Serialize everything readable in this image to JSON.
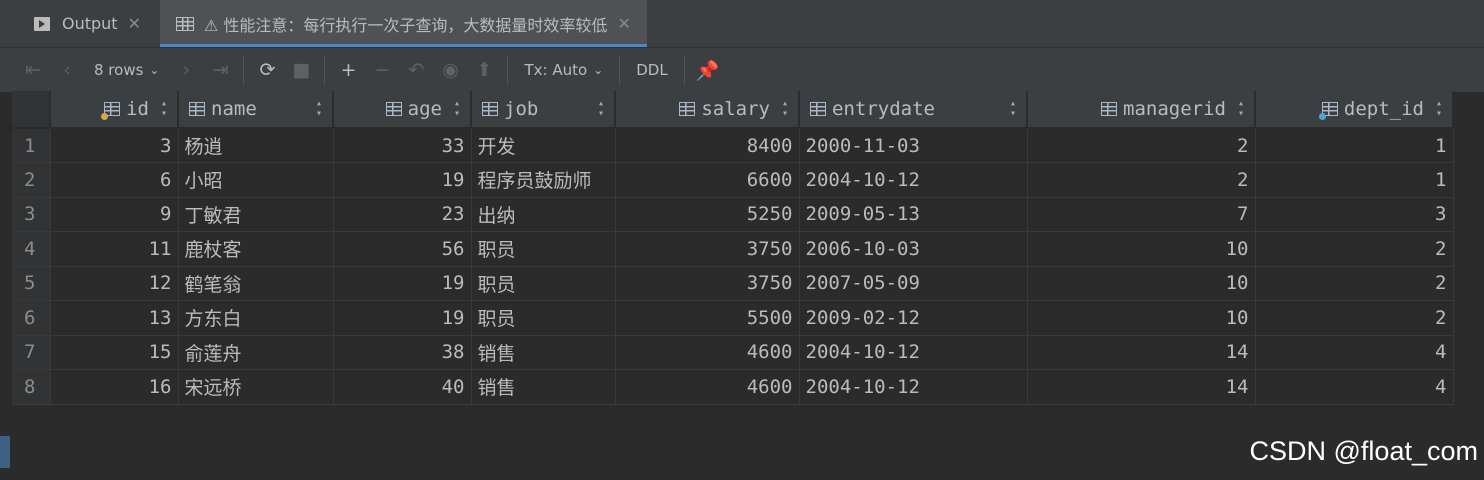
{
  "tabs": [
    {
      "label": "Output",
      "icon": "output-icon"
    },
    {
      "label": "⚠ 性能注意：每行执行一次子查询，大数据量时效率较低",
      "icon": "table-grid-icon",
      "active": true
    }
  ],
  "toolbar": {
    "rows_label": "8 rows",
    "tx_label": "Tx: Auto",
    "ddl_label": "DDL"
  },
  "columns": [
    {
      "name": "id",
      "icon": "primary-key-column-icon",
      "align": "right"
    },
    {
      "name": "name",
      "icon": "column-icon",
      "align": "left"
    },
    {
      "name": "age",
      "icon": "column-icon",
      "align": "right"
    },
    {
      "name": "job",
      "icon": "column-icon",
      "align": "left"
    },
    {
      "name": "salary",
      "icon": "column-icon",
      "align": "right"
    },
    {
      "name": "entrydate",
      "icon": "column-icon",
      "align": "left"
    },
    {
      "name": "managerid",
      "icon": "column-icon",
      "align": "right"
    },
    {
      "name": "dept_id",
      "icon": "foreign-key-column-icon",
      "align": "right"
    }
  ],
  "rows": [
    {
      "n": "1",
      "id": "3",
      "name": "杨逍",
      "age": "33",
      "job": "开发",
      "salary": "8400",
      "entrydate": "2000-11-03",
      "managerid": "2",
      "dept_id": "1"
    },
    {
      "n": "2",
      "id": "6",
      "name": "小昭",
      "age": "19",
      "job": "程序员鼓励师",
      "salary": "6600",
      "entrydate": "2004-10-12",
      "managerid": "2",
      "dept_id": "1"
    },
    {
      "n": "3",
      "id": "9",
      "name": "丁敏君",
      "age": "23",
      "job": "出纳",
      "salary": "5250",
      "entrydate": "2009-05-13",
      "managerid": "7",
      "dept_id": "3"
    },
    {
      "n": "4",
      "id": "11",
      "name": "鹿杖客",
      "age": "56",
      "job": "职员",
      "salary": "3750",
      "entrydate": "2006-10-03",
      "managerid": "10",
      "dept_id": "2"
    },
    {
      "n": "5",
      "id": "12",
      "name": "鹤笔翁",
      "age": "19",
      "job": "职员",
      "salary": "3750",
      "entrydate": "2007-05-09",
      "managerid": "10",
      "dept_id": "2"
    },
    {
      "n": "6",
      "id": "13",
      "name": "方东白",
      "age": "19",
      "job": "职员",
      "salary": "5500",
      "entrydate": "2009-02-12",
      "managerid": "10",
      "dept_id": "2"
    },
    {
      "n": "7",
      "id": "15",
      "name": "俞莲舟",
      "age": "38",
      "job": "销售",
      "salary": "4600",
      "entrydate": "2004-10-12",
      "managerid": "14",
      "dept_id": "4"
    },
    {
      "n": "8",
      "id": "16",
      "name": "宋远桥",
      "age": "40",
      "job": "销售",
      "salary": "4600",
      "entrydate": "2004-10-12",
      "managerid": "14",
      "dept_id": "4"
    }
  ],
  "watermark": "CSDN @float_com",
  "colors": {
    "background": "#2b2b2b",
    "toolbar": "#3c3f41",
    "accent": "#4a88c7"
  }
}
